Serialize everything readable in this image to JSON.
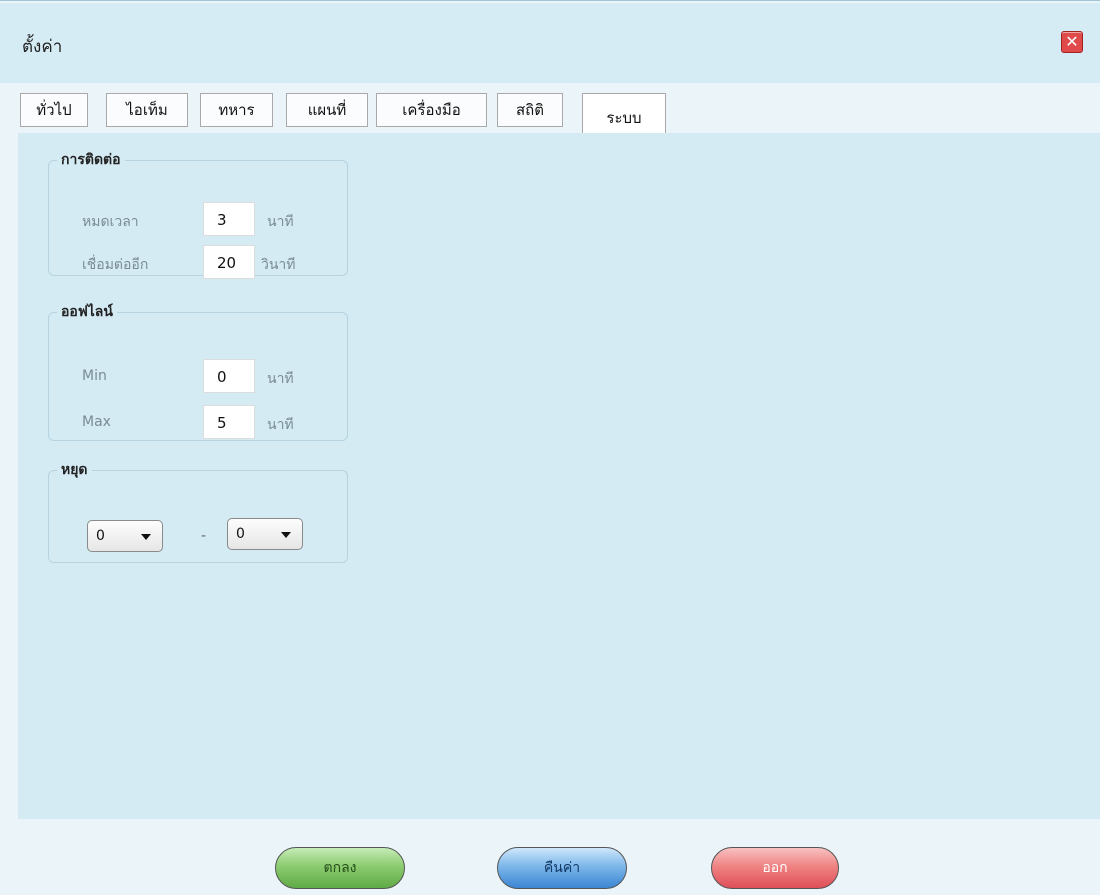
{
  "window": {
    "title": "ตั้งค่า"
  },
  "tabs": [
    {
      "label": "ทั่วไป",
      "active": false
    },
    {
      "label": "ไอเท็ม",
      "active": false
    },
    {
      "label": "ทหาร",
      "active": false
    },
    {
      "label": "แผนที่",
      "active": false
    },
    {
      "label": "เครื่องมือ",
      "active": false
    },
    {
      "label": "สถิติ",
      "active": false
    },
    {
      "label": "ระบบ",
      "active": true
    }
  ],
  "connection": {
    "legend": "การติดต่อ",
    "timeout": {
      "label": "หมดเวลา",
      "value": "3",
      "unit": "นาที"
    },
    "reconnect": {
      "label": "เชื่อมต่ออีก",
      "value": "20",
      "unit": "วินาที"
    }
  },
  "offline": {
    "legend": "ออฟไลน์",
    "min": {
      "label": "Min",
      "value": "0",
      "unit": "นาที"
    },
    "max": {
      "label": "Max",
      "value": "5",
      "unit": "นาที"
    }
  },
  "pause": {
    "legend": "หยุด",
    "from_value": "0",
    "separator": "-",
    "to_value": "0"
  },
  "buttons": {
    "ok": "ตกลง",
    "reset": "คืนค่า",
    "exit": "ออก"
  },
  "colors": {
    "content_bg": "#d4ebf4",
    "titlebar_bg": "#d6ecf5",
    "close_red": "#e04a4a"
  }
}
